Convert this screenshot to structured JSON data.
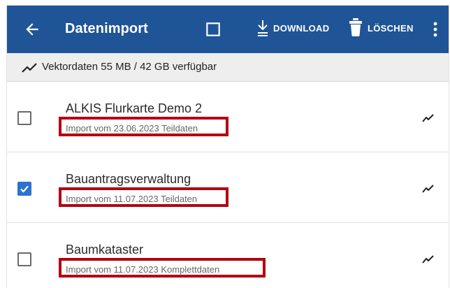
{
  "appbar": {
    "title": "Datenimport",
    "download_label": "DOWNLOAD",
    "delete_label": "LÖSCHEN",
    "background": "#1f5596"
  },
  "info": {
    "text": "Vektordaten 55 MB / 42 GB verfügbar"
  },
  "items": [
    {
      "title": "ALKIS Flurkarte Demo 2",
      "subtitle": "Import vom 23.06.2023 Teildaten",
      "checked": false,
      "highlighted": true
    },
    {
      "title": "Bauantragsverwaltung",
      "subtitle": "Import vom 11.07.2023 Teildaten",
      "checked": true,
      "highlighted": true
    },
    {
      "title": "Baumkataster",
      "subtitle": "Import vom 11.07.2023 Komplettdaten",
      "checked": false,
      "highlighted": true
    }
  ],
  "colors": {
    "accent": "#2a73d0",
    "highlight": "#b40010"
  },
  "icons": {
    "back": "arrow-left-icon",
    "select_all": "checkbox-outline-icon",
    "download": "download-icon",
    "delete": "trash-icon",
    "more": "more-vertical-icon",
    "trend": "trending-icon"
  }
}
